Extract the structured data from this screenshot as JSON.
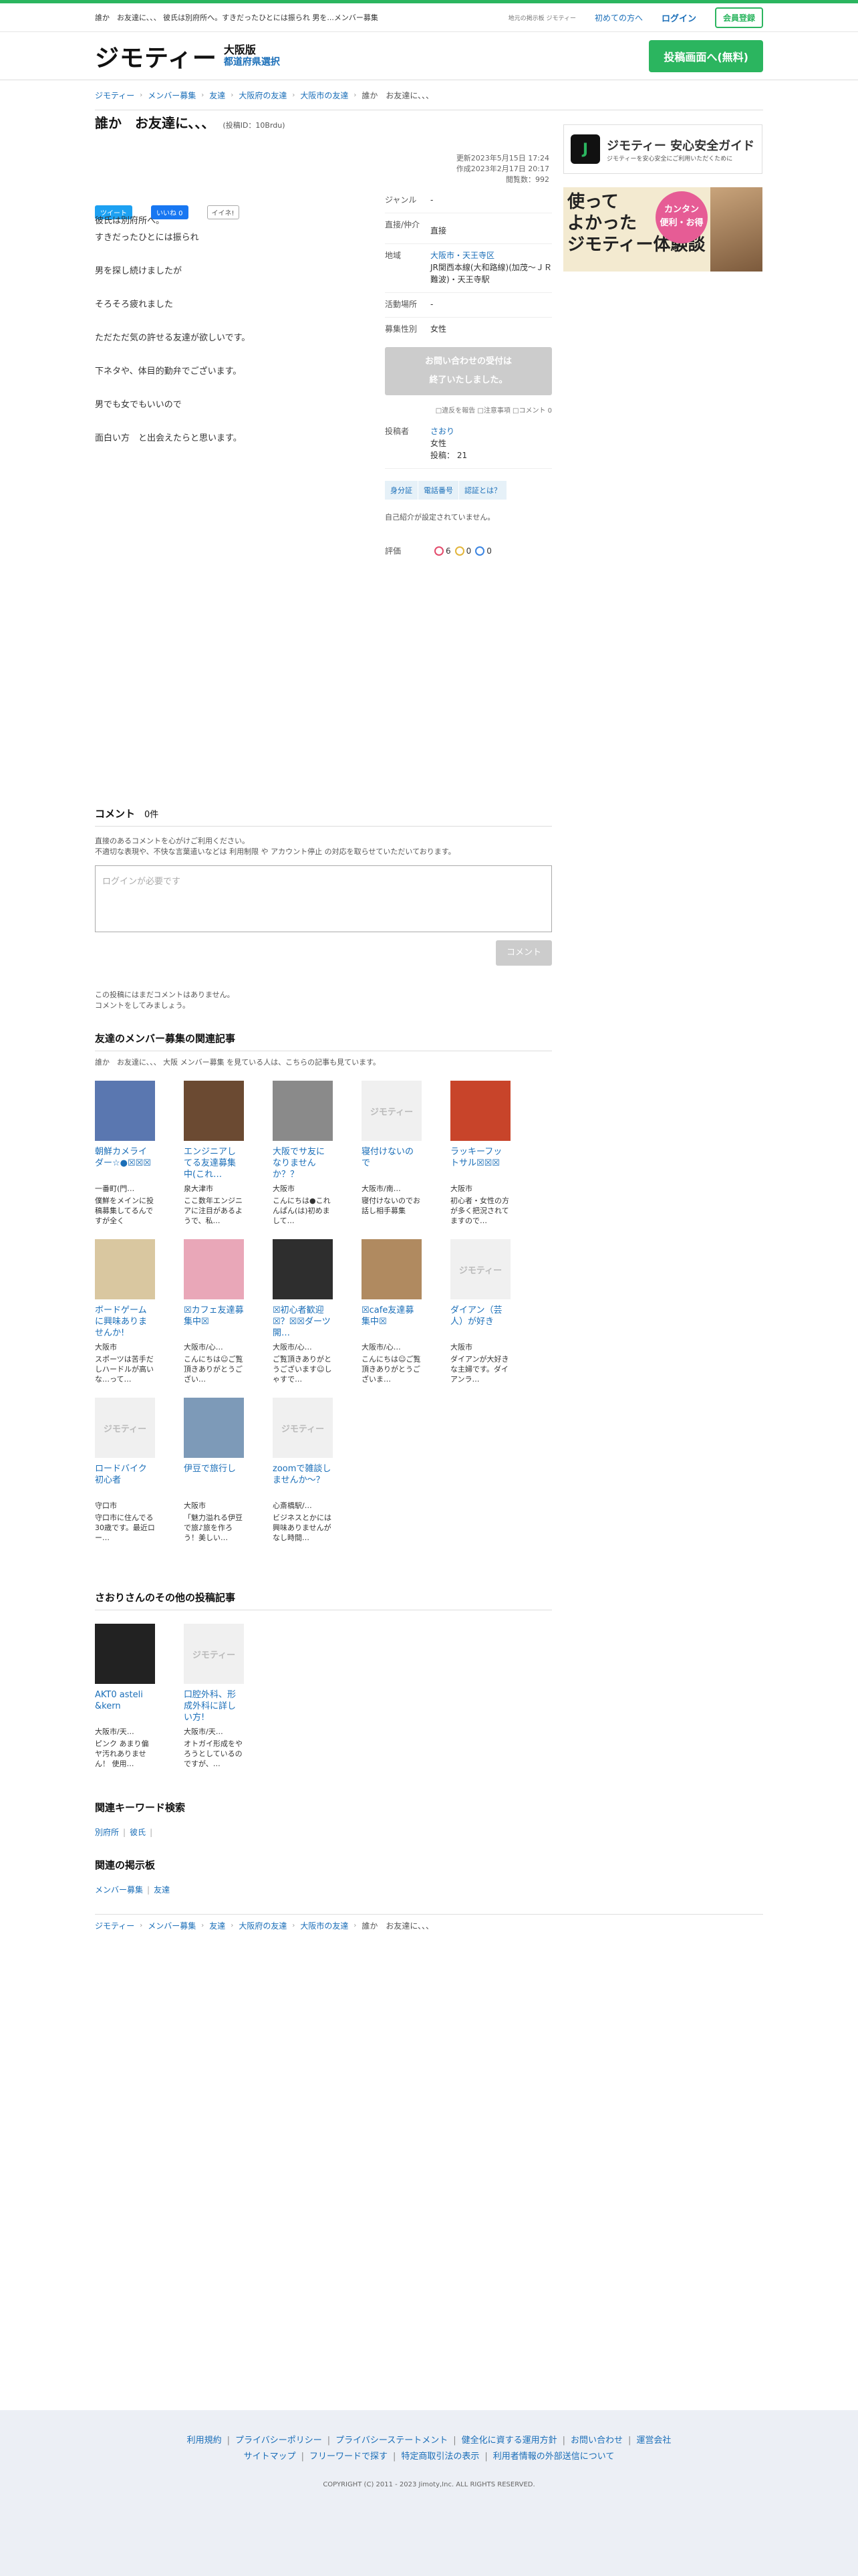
{
  "topbar": {
    "tagline": "誰か　お友達に、、、 彼氏は別府所へ。すきだったひとには振られ 男を...メンバー募集",
    "small": "地元の掲示板 ジモティー",
    "beginner": "初めての方へ",
    "login": "ログイン",
    "register": "会員登録"
  },
  "header": {
    "logo": "ジモティー",
    "region1": "大阪版",
    "region2": "都道府県選択",
    "post_button": "投稿画面へ(無料)"
  },
  "breadcrumbs": [
    "ジモティー",
    "メンバー募集",
    "友達",
    "大阪府の友達",
    "大阪市の友達",
    "誰か　お友達に、、、"
  ],
  "post": {
    "title": "誰か　お友達に、、、",
    "id_label": "(投稿ID：10Brdu)",
    "updated": "更新2023年5月15日 17:24",
    "created": "作成2023年2月17日 20:17",
    "views": "閲覧数：992",
    "body": [
      "彼氏は別府所へ。\nすきだったひとには振られ",
      "男を探し続けましたが",
      "そろそろ疲れました",
      "ただただ気の許せる友達が欲しいです。",
      "下ネタや、体目的勤弁でございます。",
      "男でも女でもいいので",
      "面白い方　と出会えたらと思います。"
    ]
  },
  "share": {
    "tweet": "ツイート",
    "facebook": "いいね 0",
    "ine": "イイネ!"
  },
  "info": {
    "genre_label": "ジャンル",
    "genre": "-",
    "method_label": "直接/仲介",
    "method": "直接",
    "area_label": "地域",
    "area": "大阪市・天王寺区",
    "station": "JR関西本線(大和路線)(加茂〜ＪＲ難波)・天王寺駅",
    "place_label": "活動場所",
    "place": "-",
    "gender_label": "募集性別",
    "gender": "女性",
    "closed": "お問い合わせの受付は\n終了いたしました。",
    "report": "□違反を報告 □注意事項 □コメント 0",
    "poster_label": "投稿者",
    "poster": "さおり",
    "poster_gender": "女性",
    "poster_posts": "投稿： 21",
    "tags": [
      "身分証",
      "電話番号",
      "認証とは？"
    ],
    "intro": "自己紹介が設定されていません。",
    "rating_label": "評価",
    "ratings": [
      "6",
      "0",
      "0"
    ]
  },
  "ads": {
    "ad1_title": "ジモティー 安心安全ガイド",
    "ad1_sub": "ジモティーを安心安全にご利用いただくために",
    "ad2_text": "使って\nよかった\nジモティー体験談",
    "ad2_circle": "カンタン\n便利・お得"
  },
  "comments": {
    "title": "コメント",
    "count": "0件",
    "note1": "直接のあるコメントを心がけご利用ください。",
    "note2": "不適切な表現や、不快な言葉遣いなどは 利用制限 や アカウント停止 の対応を取らせていただいております。",
    "placeholder": "ログインが必要です",
    "button": "コメント",
    "empty1": "この投稿にはまだコメントはありません。",
    "empty2": "コメントをしてみましょう。"
  },
  "related": {
    "title": "友達のメンバー募集の関連記事",
    "sub": "誰か　お友達に、、、 大阪 メンバー募集 を見ている人は、こちらの記事も見ています。",
    "items": [
      {
        "title": "朝鮮カメライダー☆●☒☒☒",
        "loc": "一番町(門…",
        "desc": "僕鮮をメインに投稿募集してるんですが全く",
        "img": "#5a77b0"
      },
      {
        "title": "エンジニアしてる友達募集中(これ…",
        "loc": "泉大津市",
        "desc": "ここ数年エンジニアに注目があるようで、私…",
        "img": "#6b4a32"
      },
      {
        "title": "大阪でサ友になりませんか？？",
        "loc": "大阪市",
        "desc": "こんにちは●これんぱん(は)初めまして…",
        "img": "#8a8a8a"
      },
      {
        "title": "寝付けないので",
        "loc": "大阪市/南…",
        "desc": "寝付けないのでお話し相手募集",
        "img": ""
      },
      {
        "title": "ラッキーフットサル☒☒☒",
        "loc": "大阪市",
        "desc": "初心者・女性の方が多く把況されてますので…",
        "img": "#c8442a"
      },
      {
        "title": "ボードゲームに興味ありませんか!",
        "loc": "大阪市",
        "desc": "スポーツは苦手だしハードルが高いな…って…",
        "img": "#d9c7a0"
      },
      {
        "title": "☒カフェ友達募集中☒",
        "loc": "大阪市/心…",
        "desc": "こんにちは☺ご覧頂きありがとうござい…",
        "img": "#e9a7b8"
      },
      {
        "title": "☒初心者歓迎☒？☒☒ダーツ開…",
        "loc": "大阪市/心…",
        "desc": "ご覧頂きありがとうございます☺しゃすで…",
        "img": "#2e2e2e"
      },
      {
        "title": "☒cafe友達募集中☒",
        "loc": "大阪市/心…",
        "desc": "こんにちは☺ご覧頂きありがとうございま…",
        "img": "#b08a60"
      },
      {
        "title": "ダイアン（芸人）が好き",
        "loc": "大阪市",
        "desc": "ダイアンが大好きな主婦です。ダイアンラ…",
        "img": ""
      },
      {
        "title": "ロードバイク初心者",
        "loc": "守口市",
        "desc": "守口市に住んでる30歳です。最近ロー…",
        "img": ""
      },
      {
        "title": "伊豆で旅行し",
        "loc": "大阪市",
        "desc": "「魅力溢れる伊豆で旅♪旅を作ろう！美しい…",
        "img": "#7d9ab8"
      },
      {
        "title": "zoomで雑談しませんか〜？",
        "loc": "心斎橋駅/…",
        "desc": "ビジネスとかには興味ありませんがなし時間…",
        "img": ""
      }
    ]
  },
  "other": {
    "title": "さおりさんのその他の投稿記事",
    "items": [
      {
        "title": "AKT0 asteli &kern",
        "loc": "大阪市/天…",
        "desc": "ピンク あまり偏ヤ汚れありません！ 使用…",
        "img": "#222"
      },
      {
        "title": "口腔外科、形成外科に詳しい方!",
        "loc": "大阪市/天…",
        "desc": "オトガイ形成をやろうとしているのですが、…",
        "img": ""
      }
    ]
  },
  "keywords": {
    "title": "関連キーワード検索",
    "items": [
      "別府所",
      "彼氏"
    ]
  },
  "boards": {
    "title": "関連の掲示板",
    "items": [
      "メンバー募集",
      "友達"
    ]
  },
  "noimage": "ジモティー",
  "footer": {
    "links1": [
      "利用規約",
      "プライバシーポリシー",
      "プライバシーステートメント",
      "健全化に資する運用方針",
      "お問い合わせ",
      "運営会社"
    ],
    "links2": [
      "サイトマップ",
      "フリーワードで探す",
      "特定商取引法の表示",
      "利用者情報の外部送信について"
    ],
    "copyright": "COPYRIGHT (C) 2011 - 2023 Jimoty,Inc. ALL RIGHTS RESERVED."
  }
}
